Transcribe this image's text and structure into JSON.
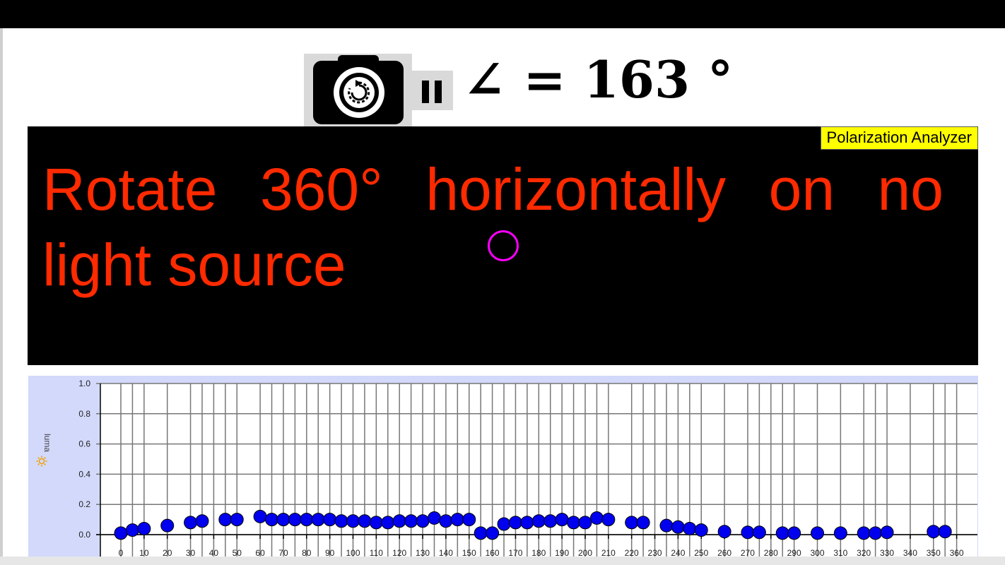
{
  "header": {
    "angle_readout": "∠ = 163 °",
    "camera_button": "camera-switch-icon",
    "pause_button": "pause-icon"
  },
  "video": {
    "badge": "Polarization Analyzer",
    "instruction": "Rotate 360° horizontally on no light source",
    "marker_color": "#ff00ff",
    "text_color": "#ff2a00"
  },
  "chart_data": {
    "type": "scatter",
    "xlabel": "",
    "ylabel": "luma",
    "ylabel_icon": "sun-icon",
    "xlim": [
      -5,
      360
    ],
    "ylim": [
      0,
      1.0
    ],
    "x_ticks": [
      0,
      10,
      20,
      30,
      40,
      50,
      60,
      70,
      80,
      90,
      100,
      110,
      120,
      130,
      140,
      150,
      160,
      170,
      180,
      190,
      200,
      210,
      220,
      230,
      240,
      250,
      260,
      270,
      280,
      290,
      300,
      310,
      320,
      330,
      340,
      350,
      360
    ],
    "y_ticks": [
      "0.0",
      "0.2",
      "0.4",
      "0.6",
      "0.8",
      "1.0"
    ],
    "grid": true,
    "point_color": "#0000ee",
    "series": [
      {
        "x": [
          0,
          5,
          10,
          20,
          30,
          35,
          45,
          50,
          60,
          65,
          70,
          75,
          80,
          85,
          90,
          95,
          100,
          105,
          110,
          115,
          120,
          125,
          130,
          135,
          140,
          145,
          150,
          155,
          160,
          165,
          170,
          175,
          180,
          185,
          190,
          195,
          200,
          205,
          210,
          220,
          225,
          235,
          240,
          245,
          250,
          260,
          270,
          275,
          285,
          290,
          300,
          310,
          320,
          325,
          330,
          350,
          355
        ],
        "y": [
          0.01,
          0.03,
          0.04,
          0.06,
          0.08,
          0.09,
          0.1,
          0.1,
          0.12,
          0.1,
          0.1,
          0.1,
          0.1,
          0.1,
          0.1,
          0.09,
          0.09,
          0.09,
          0.08,
          0.08,
          0.09,
          0.09,
          0.09,
          0.11,
          0.09,
          0.1,
          0.1,
          0.01,
          0.01,
          0.07,
          0.08,
          0.08,
          0.09,
          0.09,
          0.1,
          0.08,
          0.08,
          0.11,
          0.1,
          0.08,
          0.08,
          0.06,
          0.05,
          0.04,
          0.03,
          0.02,
          0.015,
          0.015,
          0.01,
          0.01,
          0.01,
          0.01,
          0.01,
          0.01,
          0.015,
          0.02,
          0.02
        ]
      }
    ]
  }
}
